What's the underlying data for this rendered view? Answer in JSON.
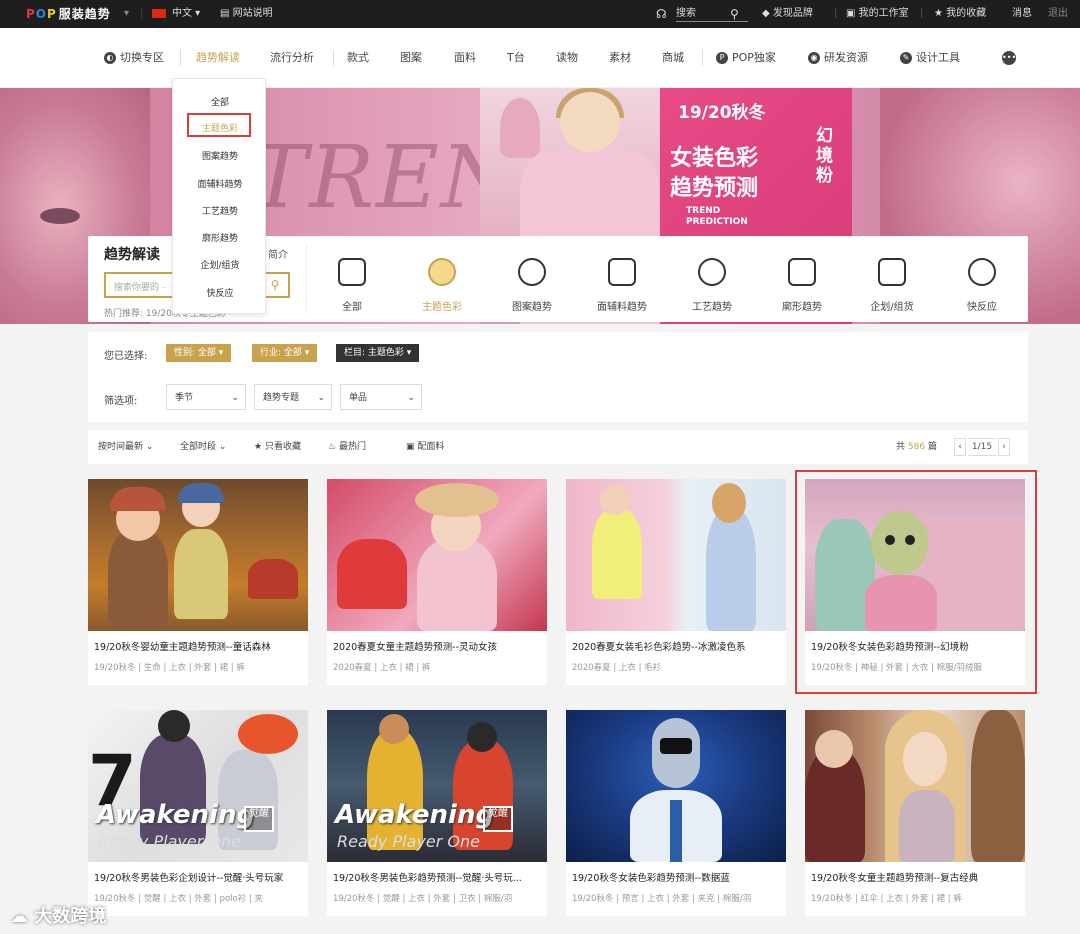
{
  "topbar": {
    "logo_a": "P",
    "logo_b": "O",
    "logo_c": "P",
    "logo_text": "服装趋势",
    "lang": "中文",
    "guide": "网站说明",
    "search_placeholder": "搜索",
    "discover": "发现品牌",
    "workspace": "我的工作室",
    "favorites": "我的收藏",
    "messages": "消息",
    "logout": "退出"
  },
  "nav": {
    "items": [
      "切换专区",
      "趋势解读",
      "流行分析",
      "款式",
      "图案",
      "面料",
      "T台",
      "读物",
      "素材",
      "商城",
      "POP独家",
      "研发资源",
      "设计工具"
    ],
    "more": "•••"
  },
  "dropdown": {
    "items": [
      "全部",
      "主题色彩",
      "图案趋势",
      "面辅料趋势",
      "工艺趋势",
      "廓形趋势",
      "企划/组货",
      "快反应"
    ]
  },
  "banner": {
    "trend_word": "TRENI",
    "season": "19/20秋冬",
    "headline1": "女装色彩",
    "headline2": "趋势预测",
    "sub1": "TREND",
    "sub2": "PREDICTION",
    "vertical": "幻境粉"
  },
  "panel": {
    "title": "趋势解读",
    "intro": "简介",
    "search_placeholder": "搜索你要的 -",
    "hot": "热门推荐: 19/20秋冬主题色彩",
    "categories": [
      "全部",
      "主题色彩",
      "图案趋势",
      "面辅料趋势",
      "工艺趋势",
      "廓形趋势",
      "企划/组货",
      "快反应"
    ]
  },
  "filters": {
    "chosen_label": "您已选择:",
    "chosen": [
      "性别: 全部",
      "行业: 全部",
      "栏目: 主题色彩"
    ],
    "filter_label": "筛选项:",
    "selects": [
      "季节",
      "趋势专题",
      "单品"
    ]
  },
  "sortbar": {
    "sort_time": "按时间最新",
    "all_time": "全部时段",
    "only_fav": "只看收藏",
    "hottest": "最热门",
    "material": "配面料",
    "total_prefix": "共",
    "total": "586",
    "total_suffix": "篇",
    "page": "1/15",
    "prev": "‹",
    "next": "›"
  },
  "cards": [
    {
      "title": "19/20秋冬婴幼童主题趋势预测--童话森林",
      "meta": "19/20秋冬 | 生命 | 上衣 | 外套 | 裙 | 裤"
    },
    {
      "title": "2020春夏女童主题趋势预测--灵动女孩",
      "meta": "2020春夏 | 上衣 | 裙 | 裤"
    },
    {
      "title": "2020春夏女装毛衫色彩趋势--冰激凌色系",
      "meta": "2020春夏 | 上衣 | 毛衫"
    },
    {
      "title": "19/20秋冬女装色彩趋势预测--幻境粉",
      "meta": "19/20秋冬 | 神秘 | 外套 | 大衣 | 棉服/羽绒服"
    },
    {
      "title": "19/20秋冬男装色彩企划设计--觉醒·头号玩家",
      "meta": "19/20秋冬 | 觉醒 | 上衣 | 外套 | polo衫 | 夹"
    },
    {
      "title": "19/20秋冬男装色彩趋势预测--觉醒·头号玩...",
      "meta": "19/20秋冬 | 觉醒 | 上衣 | 外套 | 卫衣 | 棉服/羽"
    },
    {
      "title": "19/20秋冬女装色彩趋势预测--数据蓝",
      "meta": "19/20秋冬 | 预言 | 上衣 | 外套 | 夹克 | 棉服/羽"
    },
    {
      "title": "19/20秋冬女童主题趋势预测--复古经典",
      "meta": "19/20秋冬 | 红伞 | 上衣 | 外套 | 裙 | 裤"
    }
  ],
  "awakening": {
    "word": "Awakening",
    "sub": "Ready Player One",
    "badge": "觉醒"
  },
  "watermark": "大数跨境",
  "colors": {
    "accent": "#c9a24e",
    "highlight": "#d9403a",
    "topbar": "#1e1e1e"
  }
}
